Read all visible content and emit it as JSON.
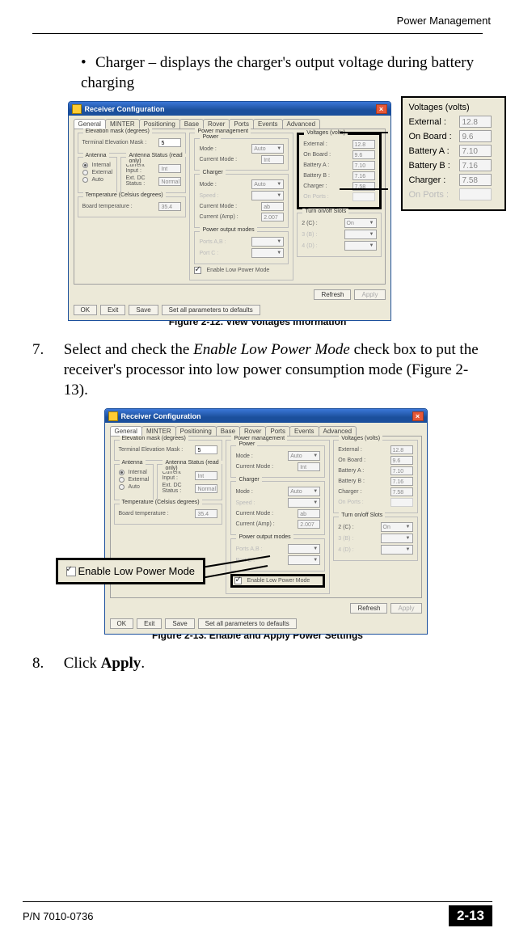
{
  "header": {
    "section": "Power Management"
  },
  "bullet": {
    "text": "Charger – displays the charger's output voltage during battery charging"
  },
  "figure12": {
    "caption": "Figure 2-12. View Voltages Information"
  },
  "figure13": {
    "caption": "Figure 2-13. Enable and Apply Power Settings"
  },
  "step7": {
    "num": "7.",
    "text_a": "Select and check the ",
    "emph": "Enable Low Power Mode",
    "text_b": " check box to put the receiver's processor into low power consumption mode (Figure 2-13)."
  },
  "step8": {
    "num": "8.",
    "text_a": "Click ",
    "bold": "Apply",
    "text_b": "."
  },
  "footer": {
    "pn": "P/N 7010-0736",
    "page": "2-13"
  },
  "rc": {
    "title": "Receiver Configuration",
    "tabs": [
      "General",
      "MINTER",
      "Positioning",
      "Base",
      "Rover",
      "Ports",
      "Events",
      "Advanced"
    ],
    "elev": {
      "group": "Elevation mask (degrees)",
      "label": "Terminal Elevation Mask :",
      "value": "5"
    },
    "antenna": {
      "group": "Antenna",
      "opts": [
        "Internal",
        "External",
        "Auto"
      ],
      "status_group": "Antenna Status (read only)",
      "ci_label": "Current Input :",
      "ci_value": "Int",
      "dc_label": "Ext. DC Status :",
      "dc_value": "Normal"
    },
    "temp": {
      "group": "Temperature (Celsius degrees)",
      "label": "Board temperature :",
      "value": "35.4"
    },
    "pm": {
      "group": "Power management",
      "power_group": "Power",
      "mode_label": "Mode :",
      "mode_value": "Auto",
      "cmode_label": "Current Mode :",
      "cmode_value": "Int",
      "charger_group": "Charger",
      "ch_mode_label": "Mode :",
      "ch_mode_value": "Auto",
      "speed_label": "Speed :",
      "ch_cmode_label": "Current Mode :",
      "ch_cmode_value": "ab",
      "amp_label": "Current (Amp) :",
      "amp_value": "2.007",
      "output_group": "Power output modes",
      "ports_label": "Ports A,B :",
      "portc_label": "Port C :",
      "enable_label": "Enable Low Power Mode"
    },
    "volts": {
      "group": "Voltages (volts)",
      "rows": {
        "ext": {
          "label": "External :",
          "value": "12.8"
        },
        "ob": {
          "label": "On Board :",
          "value": "9.6"
        },
        "ba": {
          "label": "Battery A :",
          "value": "7.10"
        },
        "bb": {
          "label": "Battery B :",
          "value": "7.16"
        },
        "chg": {
          "label": "Charger :",
          "value": "7.58"
        },
        "op": {
          "label": "On Ports :",
          "value": ""
        }
      }
    },
    "slots": {
      "group": "Turn on/off Slots",
      "r1": "2 (C) :",
      "r1v": "On",
      "r2": "3 (B) :",
      "r3": "4 (D) :"
    },
    "buttons": {
      "ok": "OK",
      "exit": "Exit",
      "save": "Save",
      "defaults": "Set all parameters to defaults",
      "refresh": "Refresh",
      "apply": "Apply"
    }
  },
  "callout1": {
    "title": "Voltages (volts)",
    "ext_l": "External :",
    "ext_v": "12.8",
    "ob_l": "On Board :",
    "ob_v": "9.6",
    "ba_l": "Battery A :",
    "ba_v": "7.10",
    "bb_l": "Battery B :",
    "bb_v": "7.16",
    "chg_l": "Charger :",
    "chg_v": "7.58",
    "op_l": "On Ports :"
  },
  "callout2": {
    "label": "Enable Low Power Mode"
  }
}
